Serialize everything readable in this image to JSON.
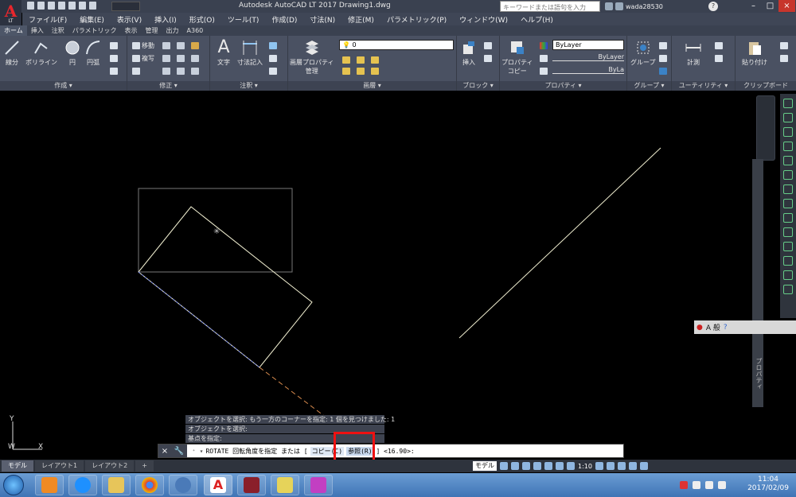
{
  "title": {
    "app_logo": "A",
    "app_logo_sub": "LT",
    "window_title": "Autodesk AutoCAD LT 2017    Drawing1.dwg",
    "search_placeholder": "キーワードまたは語句を入力",
    "user": "wada28530"
  },
  "menu": [
    "ファイル(F)",
    "編集(E)",
    "表示(V)",
    "挿入(I)",
    "形式(O)",
    "ツール(T)",
    "作成(D)",
    "寸法(N)",
    "修正(M)",
    "パラメトリック(P)",
    "ウィンドウ(W)",
    "ヘルプ(H)"
  ],
  "ribbon_tabs": [
    "ホーム",
    "挿入",
    "注釈",
    "パラメトリック",
    "表示",
    "管理",
    "出力",
    "A360"
  ],
  "ribbon": {
    "draw": {
      "title": "作成 ▾",
      "line": "線分",
      "polyline": "ポリライン",
      "circle": "円",
      "arc": "円弧"
    },
    "modify": {
      "title": "修正 ▾",
      "move": "移動",
      "copy": "複写"
    },
    "annotation": {
      "title": "注釈 ▾",
      "text": "文字",
      "dimension": "寸法記入"
    },
    "layers": {
      "title": "画層 ▾",
      "layer_props": "画層プロパティ",
      "manage": "管理",
      "current_layer": "0"
    },
    "block": {
      "title": "ブロック ▾",
      "insert": "挿入"
    },
    "properties": {
      "title": "プロパティ ▾",
      "copy_props_1": "プロパティ",
      "copy_props_2": "コピー",
      "color": "ByLayer",
      "linetype": "ByLayer",
      "lineweight": "ByLa"
    },
    "groups": {
      "title": "グループ ▾",
      "group": "グループ"
    },
    "utilities": {
      "title": "ユーティリティ ▾",
      "measure": "計測"
    },
    "clipboard": {
      "title": "クリップボード",
      "paste": "貼り付け"
    }
  },
  "canvas": {
    "side_label": "プロパティ",
    "ime": "A 般"
  },
  "command": {
    "history": [
      "オブジェクトを選択: もう一方のコーナーを指定: 1 個を見つけました: 1",
      "オブジェクトを選択:",
      "基点を指定:"
    ],
    "prompt_prefix": "ROTATE 回転角度を指定 または [",
    "opt_copy": "コピー(C)",
    "opt_reference": "参照(R)",
    "prompt_suffix": "] <16.90>:"
  },
  "layout_tabs": [
    "モデル",
    "レイアウト1",
    "レイアウト2",
    "+"
  ],
  "status": {
    "model": "モデル",
    "scale": "1:10"
  },
  "clock": {
    "time": "11:04",
    "date": "2017/02/09"
  },
  "colors": {
    "accent": "#e11111",
    "ribbon_bg": "#4a5162",
    "titlebar": "#3a4150"
  }
}
